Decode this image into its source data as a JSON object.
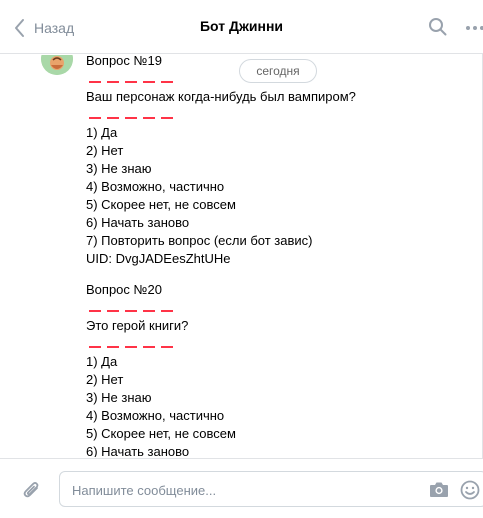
{
  "header": {
    "back_label": "Назад",
    "title": "Бот Джинни"
  },
  "date_pill": "сегодня",
  "message1": {
    "question_title": "Вопрос №19",
    "question": "Ваш персонаж когда-нибудь был вампиром?",
    "options": [
      "1) Да",
      "2) Нет",
      "3) Не знаю",
      "4) Возможно, частично",
      "5) Скорее нет, не совсем",
      "6) Начать заново",
      "7) Повторить вопрос (если бот завис)"
    ],
    "uid": "UID: DvgJADEesZhtUHe"
  },
  "message2": {
    "question_title": "Вопрос №20",
    "question": "Это герой книги?",
    "options": [
      "1) Да",
      "2) Нет",
      "3) Не знаю",
      "4) Возможно, частично",
      "5) Скорее нет, не совсем",
      "6) Начать заново"
    ]
  },
  "composer": {
    "placeholder": "Напишите сообщение..."
  },
  "colors": {
    "accent": "#818c99",
    "divider_red": "#ff3347",
    "border": "#e1e3e6"
  },
  "icons": [
    "chevron-left-icon",
    "search-icon",
    "more-icon",
    "avatar",
    "paperclip-icon",
    "camera-icon",
    "smile-icon"
  ]
}
